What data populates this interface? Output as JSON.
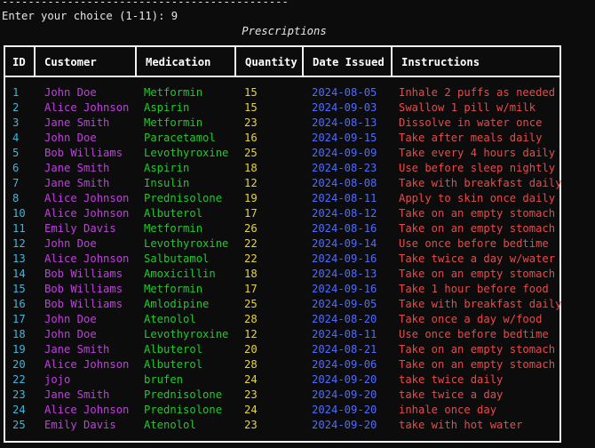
{
  "terminal": {
    "divider": "--------------------------------------------",
    "prompt": "Enter your choice (1-11): 9",
    "table_title": "Prescriptions"
  },
  "table": {
    "headers": [
      "ID",
      "Customer",
      "Medication",
      "Quantity",
      "Date Issued",
      "Instructions"
    ],
    "rows": [
      [
        "1",
        "John Doe",
        "Metformin",
        "15",
        "2024-08-05",
        "Inhale 2 puffs as needed"
      ],
      [
        "2",
        "Alice Johnson",
        "Aspirin",
        "15",
        "2024-09-03",
        "Swallow 1 pill w/milk"
      ],
      [
        "3",
        "Jane Smith",
        "Metformin",
        "23",
        "2024-08-13",
        "Dissolve in water once"
      ],
      [
        "4",
        "John Doe",
        "Paracetamol",
        "16",
        "2024-09-15",
        "Take after meals daily"
      ],
      [
        "5",
        "Bob Williams",
        "Levothyroxine",
        "25",
        "2024-09-09",
        "Take every 4 hours daily"
      ],
      [
        "6",
        "Jane Smith",
        "Aspirin",
        "18",
        "2024-08-23",
        "Use before sleep nightly"
      ],
      [
        "7",
        "Jane Smith",
        "Insulin",
        "12",
        "2024-08-08",
        "Take with breakfast daily"
      ],
      [
        "8",
        "Alice Johnson",
        "Prednisolone",
        "19",
        "2024-08-11",
        "Apply to skin once daily"
      ],
      [
        "10",
        "Alice Johnson",
        "Albuterol",
        "17",
        "2024-08-12",
        "Take on an empty stomach"
      ],
      [
        "11",
        "Emily Davis",
        "Metformin",
        "26",
        "2024-08-16",
        "Take on an empty stomach"
      ],
      [
        "12",
        "John Doe",
        "Levothyroxine",
        "22",
        "2024-09-14",
        "Use once before bedtime"
      ],
      [
        "13",
        "Alice Johnson",
        "Salbutamol",
        "22",
        "2024-09-16",
        "Take twice a day w/water"
      ],
      [
        "14",
        "Bob Williams",
        "Amoxicillin",
        "18",
        "2024-08-13",
        "Take on an empty stomach"
      ],
      [
        "15",
        "Bob Williams",
        "Metformin",
        "17",
        "2024-09-16",
        "Take 1 hour before food"
      ],
      [
        "16",
        "Bob Williams",
        "Amlodipine",
        "25",
        "2024-09-05",
        "Take with breakfast daily"
      ],
      [
        "17",
        "John Doe",
        "Atenolol",
        "28",
        "2024-08-20",
        "Take once a day w/food"
      ],
      [
        "18",
        "John Doe",
        "Levothyroxine",
        "12",
        "2024-08-11",
        "Use once before bedtime"
      ],
      [
        "19",
        "Jane Smith",
        "Albuterol",
        "20",
        "2024-08-21",
        "Take on an empty stomach"
      ],
      [
        "20",
        "Alice Johnson",
        "Albuterol",
        "28",
        "2024-09-06",
        "Take on an empty stomach"
      ],
      [
        "22",
        "jojo",
        "brufen",
        "24",
        "2024-09-20",
        "take twice daily"
      ],
      [
        "23",
        "Jane Smith",
        "Prednisolone",
        "23",
        "2024-09-20",
        "take twice a day"
      ],
      [
        "24",
        "Alice Johnson",
        "Prednisolone",
        "24",
        "2024-09-20",
        "inhale once day"
      ],
      [
        "25",
        "Emily Davis",
        "Atenolol",
        "23",
        "2024-09-20",
        "take with hot water"
      ]
    ]
  },
  "colors": {
    "background": "#0c0c0c",
    "id": "#3fb6dc",
    "customer": "#c13fe0",
    "medication": "#1ecb2a",
    "quantity": "#e6d634",
    "date": "#4f6bff",
    "instructions": "#e84a4a"
  }
}
